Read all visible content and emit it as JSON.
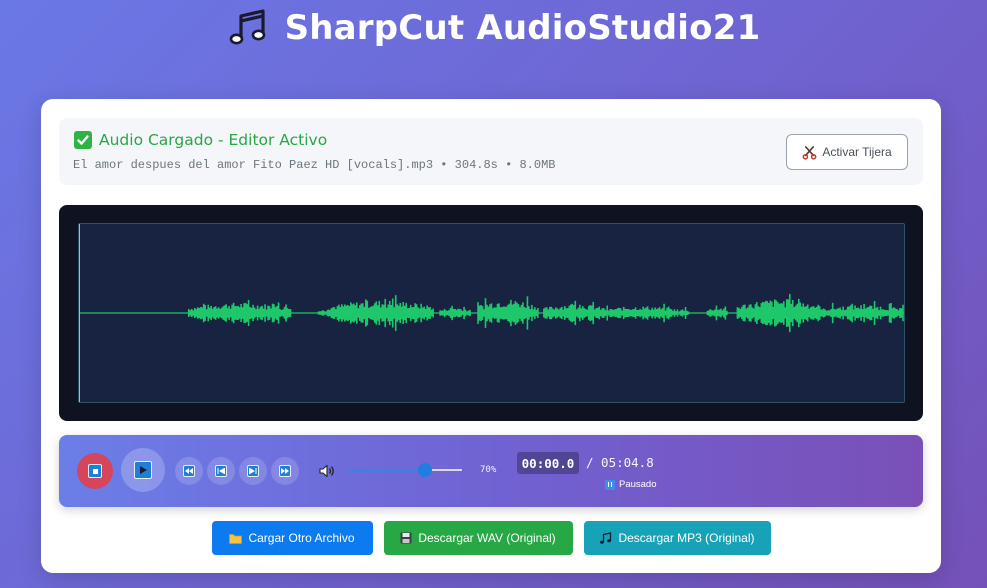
{
  "app": {
    "title": "SharpCut AudioStudio21",
    "icon": "music-notes-icon"
  },
  "file_panel": {
    "status_label": "Audio Cargado - Editor Activo",
    "status_icon": "check-icon",
    "file_meta": "El amor despues del amor Fito Paez HD [vocals].mp3 • 304.8s • 8.0MB",
    "scissors_button_label": "Activar Tijera",
    "scissors_icon": "scissors-icon"
  },
  "waveform": {
    "color": "#1ec86a",
    "background": "#172341",
    "playhead_position": 0
  },
  "player": {
    "stop_icon": "stop-icon",
    "play_icon": "play-icon",
    "skip_buttons": [
      {
        "name": "rewind-fast-button",
        "icon": "rewind-fast-icon"
      },
      {
        "name": "rewind-button",
        "icon": "rewind-icon"
      },
      {
        "name": "forward-button",
        "icon": "forward-icon"
      },
      {
        "name": "forward-fast-button",
        "icon": "forward-fast-icon"
      }
    ],
    "volume_icon": "speaker-icon",
    "volume_level": 0.7,
    "volume_label": "70%",
    "current_time": "00:00.0",
    "total_time": "/ 05:04.8",
    "play_state": "Pausado",
    "play_state_icon": "pause-icon"
  },
  "actions": {
    "load_label": "Cargar Otro Archivo",
    "load_icon": "folder-icon",
    "wav_label": "Descargar WAV (Original)",
    "wav_icon": "floppy-disk-icon",
    "mp3_label": "Descargar MP3 (Original)",
    "mp3_icon": "music-note-icon"
  },
  "colors": {
    "accent": "#0d7bf0",
    "success": "#28a745",
    "info": "#18a2b8",
    "stop": "#d5455c"
  }
}
